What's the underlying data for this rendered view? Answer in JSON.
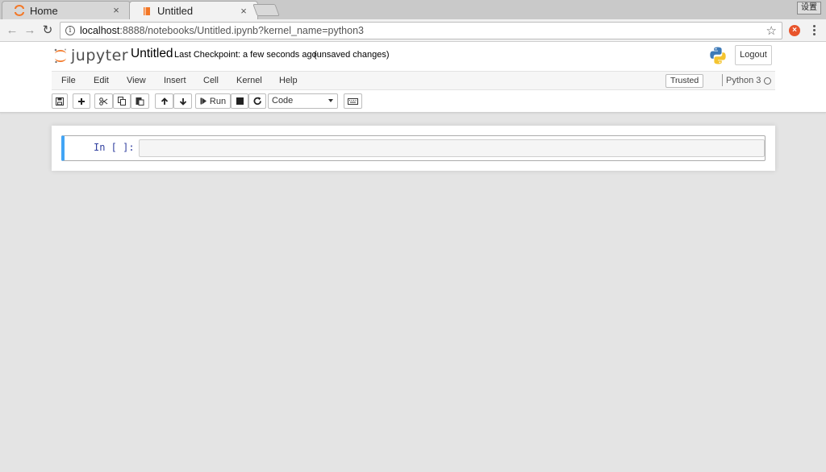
{
  "browser": {
    "tabs": [
      {
        "label": "Home",
        "close": "×"
      },
      {
        "label": "Untitled",
        "close": "×"
      }
    ],
    "badge": "设置",
    "url_host": "localhost",
    "url_path": ":8888/notebooks/Untitled.ipynb?kernel_name=python3"
  },
  "header": {
    "logo_text": "jupyter",
    "notebook_title": "Untitled",
    "checkpoint": "Last Checkpoint: a few seconds ago",
    "unsaved": "(unsaved changes)",
    "logout_label": "Logout"
  },
  "menubar": {
    "items": [
      "File",
      "Edit",
      "View",
      "Insert",
      "Cell",
      "Kernel",
      "Help"
    ],
    "trusted": "Trusted",
    "kernel_name": "Python 3"
  },
  "toolbar": {
    "run_label": "Run",
    "cell_type": "Code"
  },
  "cell": {
    "prompt": "In [ ]:"
  },
  "colors": {
    "jupyter_orange": "#f37726",
    "cell_selected": "#42a5f5",
    "prompt_blue": "#303f9f"
  }
}
